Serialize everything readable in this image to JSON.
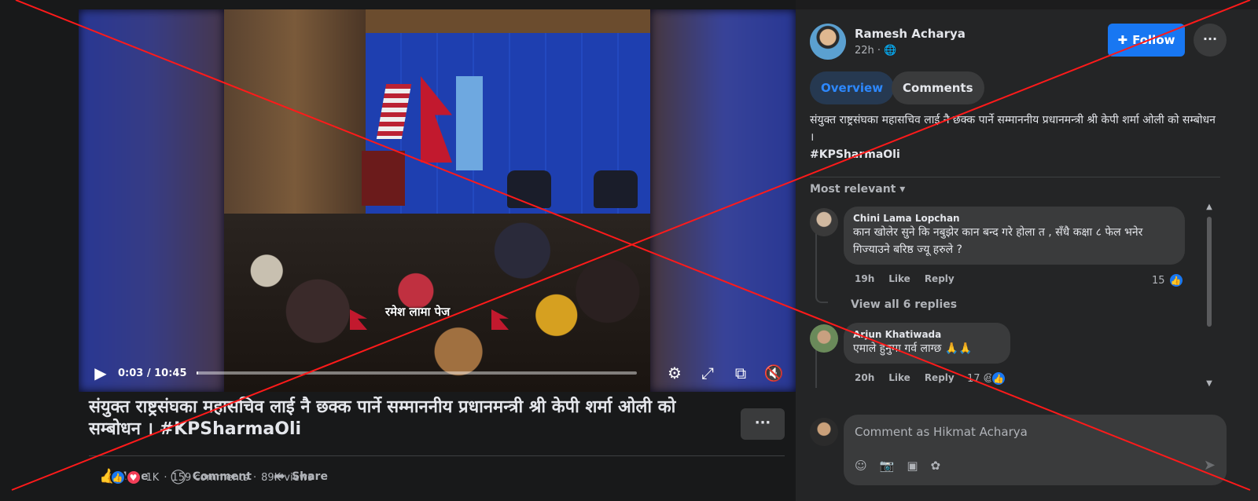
{
  "video": {
    "caption_overlay": "रमेश लामा पेज",
    "time": "0:03 / 10:45",
    "progress": 0.005,
    "icons": [
      "play-icon",
      "gear-icon",
      "fullscreen-icon",
      "pip-icon",
      "mute-icon"
    ]
  },
  "post": {
    "title": "संयुक्त राष्ट्रसंघका महासचिव लाई नै छक्क पार्ने सम्माननीय प्रधानमन्त्री श्री केपी शर्मा ओली को सम्बोधन । #KPSharmaOli",
    "more": "···",
    "actions": {
      "like": "Like",
      "comment": "Comment",
      "share": "Share"
    },
    "stats": {
      "reactions": "1K",
      "comments": "159 comments",
      "views": "89K views"
    }
  },
  "sidebar": {
    "author": "Ramesh Acharya",
    "time": "22h",
    "follow_label": "Follow",
    "more": "···",
    "tabs": [
      "Overview",
      "Comments"
    ],
    "description": "संयुक्त राष्ट्रसंघका महासचिव लाई नै छक्क पार्ने सम्माननीय प्रधानमन्त्री श्री केपी शर्मा ओली को सम्बोधन ।",
    "hashtag": "#KPSharmaOli",
    "sort_label": "Most relevant"
  },
  "comments": [
    {
      "name": "Chini Lama Lopchan",
      "text": "कान खोलेर सुने कि नबुझेर कान बन्द गरे होला त , सँधै कक्षा ८ फेल भनेर गिज्याउने बरिष्ठ ज्यू हरुले ?",
      "time": "19h",
      "like": "Like",
      "reply": "Reply",
      "count": "15",
      "view_replies": "View all 6 replies"
    },
    {
      "name": "Arjun Khatiwada",
      "text": "एमाले हुनुमा गर्व लाग्छ 🙏🙏",
      "time": "20h",
      "like": "Like",
      "reply": "Reply",
      "count": "17"
    }
  ],
  "composer": {
    "placeholder": "Comment as Hikmat Acharya"
  }
}
